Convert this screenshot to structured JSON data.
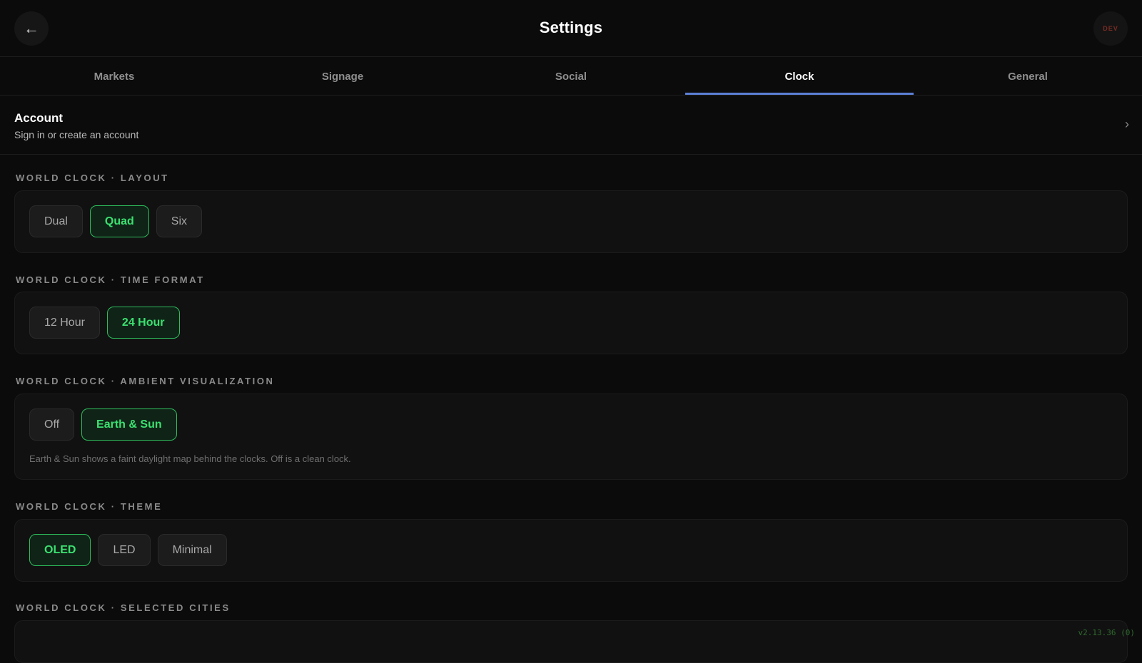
{
  "header": {
    "back_icon": "←",
    "title": "Settings",
    "badge": "DEV"
  },
  "tabs": [
    {
      "label": "Markets",
      "active": false
    },
    {
      "label": "Signage",
      "active": false
    },
    {
      "label": "Social",
      "active": false
    },
    {
      "label": "Clock",
      "active": true
    },
    {
      "label": "General",
      "active": false
    }
  ],
  "account": {
    "title": "Account",
    "subtitle": "Sign in or create an account",
    "chevron": "›"
  },
  "sections": {
    "layout": {
      "label": "WORLD CLOCK · LAYOUT",
      "options": [
        "Dual",
        "Quad",
        "Six"
      ],
      "selected": "Quad"
    },
    "time_format": {
      "label": "WORLD CLOCK · TIME FORMAT",
      "options": [
        "12 Hour",
        "24 Hour"
      ],
      "selected": "24 Hour"
    },
    "ambient": {
      "label": "WORLD CLOCK · AMBIENT VISUALIZATION",
      "options": [
        "Off",
        "Earth & Sun"
      ],
      "selected": "Earth & Sun",
      "note": "Earth & Sun shows a faint daylight map behind the clocks. Off is a clean clock."
    },
    "theme": {
      "label": "WORLD CLOCK · THEME",
      "options": [
        "OLED",
        "LED",
        "Minimal"
      ],
      "selected": "OLED"
    },
    "cities": {
      "label": "WORLD CLOCK · SELECTED CITIES"
    }
  },
  "version": "v2.13.36 (0)",
  "colors": {
    "accent_tab": "#5b7fd6",
    "selected_text": "#3ce070",
    "selected_border": "#2ebd5c",
    "badge": "#7a2c24"
  }
}
